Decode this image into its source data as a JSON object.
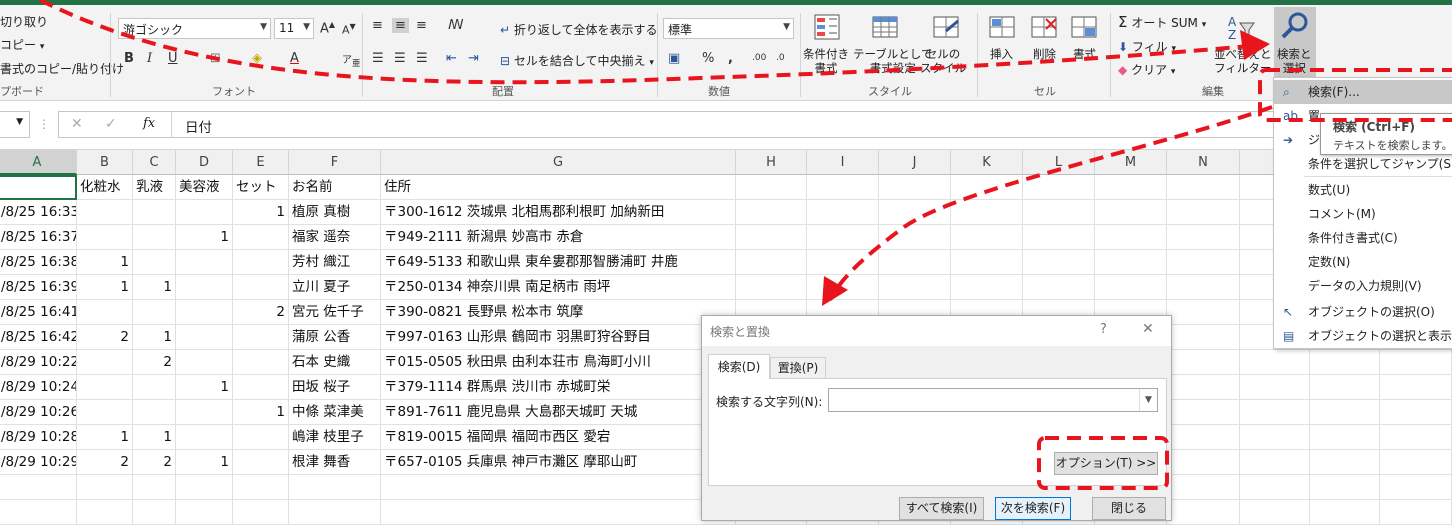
{
  "ribbon": {
    "clipboard": {
      "cut": "切り取り",
      "copy": "コピー",
      "format_painter": "書式のコピー/貼り付け",
      "group_label": "プボード"
    },
    "font": {
      "font_name": "游ゴシック",
      "font_size": "11",
      "group_label": "フォント"
    },
    "alignment": {
      "wrap_text": "折り返して全体を表示する",
      "merge_center": "セルを結合して中央揃え",
      "group_label": "配置"
    },
    "number": {
      "format": "標準",
      "group_label": "数値"
    },
    "styles": {
      "conditional": "条件付き\n書式",
      "as_table": "テーブルとして\n書式設定",
      "cell_styles": "セルの\nスタイル",
      "group_label": "スタイル"
    },
    "cells": {
      "insert": "挿入",
      "delete": "削除",
      "format": "書式",
      "group_label": "セル"
    },
    "editing": {
      "autosum": "オート SUM",
      "fill": "フィル",
      "clear": "クリア",
      "sort_filter": "並べ替えと\nフィルター",
      "find_select": "検索と\n選択",
      "group_label": "編集"
    }
  },
  "formula_bar": {
    "fx": "fx",
    "content": "日付"
  },
  "sheet": {
    "columns": [
      "A",
      "B",
      "C",
      "D",
      "E",
      "F",
      "G",
      "H",
      "I",
      "J",
      "K",
      "L",
      "M",
      "N"
    ],
    "header_row": [
      "",
      "化粧水",
      "乳液",
      "美容液",
      "セット",
      "お名前",
      "住所"
    ],
    "rows": [
      [
        "/8/25 16:33",
        "",
        "",
        "",
        "1",
        "植原 真樹",
        "〒300-1612 茨城県 北相馬郡利根町 加納新田"
      ],
      [
        "/8/25 16:37",
        "",
        "",
        "1",
        "",
        "福家 遥奈",
        "〒949-2111 新潟県 妙高市 赤倉"
      ],
      [
        "/8/25 16:38",
        "1",
        "",
        "",
        "",
        "芳村 織江",
        "〒649-5133 和歌山県 東牟婁郡那智勝浦町 井鹿"
      ],
      [
        "/8/25 16:39",
        "1",
        "1",
        "",
        "",
        "立川 夏子",
        "〒250-0134 神奈川県 南足柄市 雨坪"
      ],
      [
        "/8/25 16:41",
        "",
        "",
        "",
        "2",
        "宮元 佐千子",
        "〒390-0821 長野県 松本市 筑摩"
      ],
      [
        "/8/25 16:42",
        "2",
        "1",
        "",
        "",
        "蒲原 公香",
        "〒997-0163 山形県 鶴岡市 羽黒町狩谷野目"
      ],
      [
        "/8/29 10:22",
        "",
        "2",
        "",
        "",
        "石本 史織",
        "〒015-0505 秋田県 由利本荘市 鳥海町小川"
      ],
      [
        "/8/29 10:24",
        "",
        "",
        "1",
        "",
        "田坂 桜子",
        "〒379-1114 群馬県 渋川市 赤城町栄"
      ],
      [
        "/8/29 10:26",
        "",
        "",
        "",
        "1",
        "中條 菜津美",
        "〒891-7611 鹿児島県 大島郡天城町 天城"
      ],
      [
        "/8/29 10:28",
        "1",
        "1",
        "",
        "",
        "嶋津 枝里子",
        "〒819-0015 福岡県 福岡市西区 愛宕"
      ],
      [
        "/8/29 10:29",
        "2",
        "2",
        "1",
        "",
        "根津 舞香",
        "〒657-0105 兵庫県 神戸市灘区 摩耶山町"
      ]
    ]
  },
  "dialog": {
    "title": "検索と置換",
    "help": "?",
    "close": "✕",
    "tab_find": "検索(D)",
    "tab_replace": "置換(P)",
    "find_label": "検索する文字列(N):",
    "find_value": "",
    "options_btn": "オプション(T) >>",
    "find_all_btn": "すべて検索(I)",
    "find_next_btn": "次を検索(F)",
    "close_btn": "閉じる"
  },
  "find_menu": {
    "items": [
      {
        "label": "検索(F)...",
        "icon": "search-icon"
      },
      {
        "label": "置",
        "icon": "replace-icon"
      },
      {
        "label": "ジ",
        "icon": "goto-arrow-icon"
      },
      {
        "label": "条件を選択してジャンプ(S)...",
        "icon": ""
      },
      {
        "label": "数式(U)",
        "icon": ""
      },
      {
        "label": "コメント(M)",
        "icon": ""
      },
      {
        "label": "条件付き書式(C)",
        "icon": ""
      },
      {
        "label": "定数(N)",
        "icon": ""
      },
      {
        "label": "データの入力規則(V)",
        "icon": ""
      },
      {
        "label": "オブジェクトの選択(O)",
        "icon": "cursor-icon"
      },
      {
        "label": "オブジェクトの選択と表示(P)...",
        "icon": "select-pane-icon"
      }
    ]
  },
  "tooltip": {
    "title": "検索 (Ctrl+F)",
    "desc": "テキストを検索します。"
  },
  "colors": {
    "excel_green": "#217346",
    "annotation_red": "#e8141e"
  }
}
